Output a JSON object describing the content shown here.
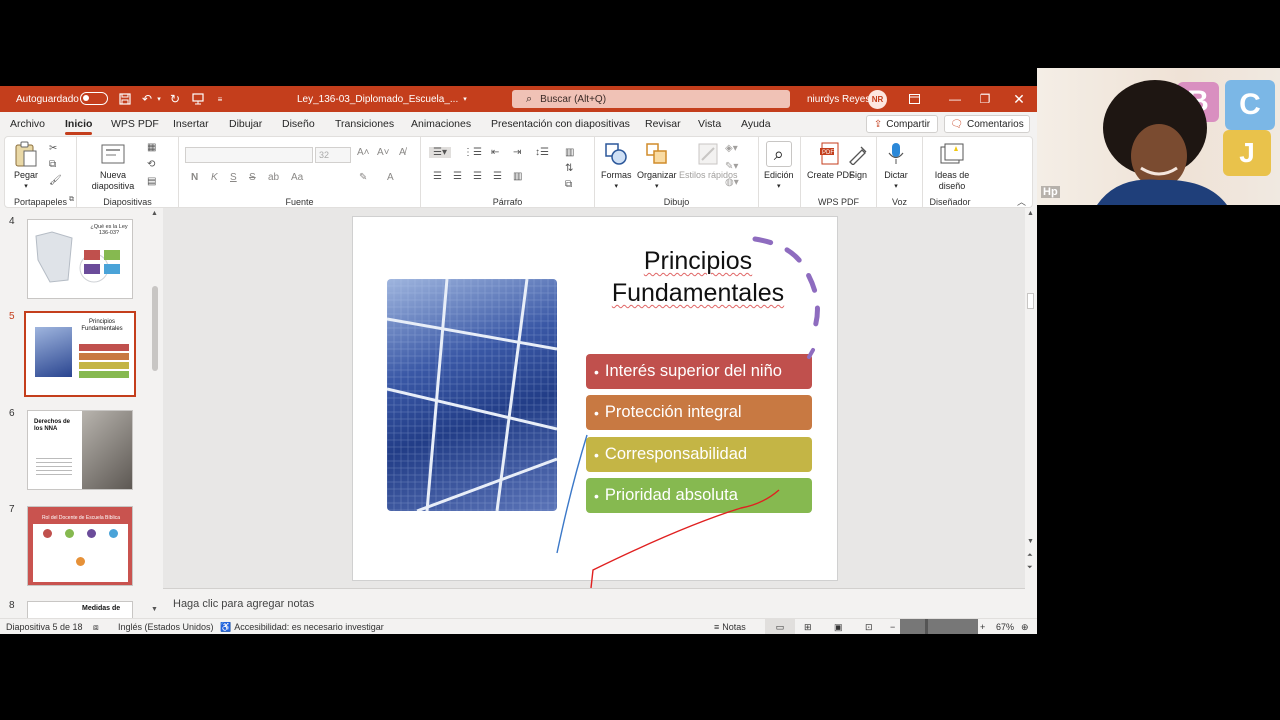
{
  "titlebar": {
    "autosave_label": "Autoguardado",
    "filename": "Ley_136-03_Diplomado_Escuela_...",
    "search_placeholder": "Buscar (Alt+Q)",
    "user_name": "niurdys Reyes",
    "user_initials": "NR"
  },
  "tabs": [
    "Archivo",
    "Inicio",
    "WPS PDF",
    "Insertar",
    "Dibujar",
    "Diseño",
    "Transiciones",
    "Animaciones",
    "Presentación con diapositivas",
    "Revisar",
    "Vista",
    "Ayuda"
  ],
  "active_tab": "Inicio",
  "share_label": "Compartir",
  "comments_label": "Comentarios",
  "ribbon": {
    "groups": {
      "clipboard": "Portapapeles",
      "slides": "Diapositivas",
      "font": "Fuente",
      "paragraph": "Párrafo",
      "drawing": "Dibujo",
      "wpspdf": "WPS PDF",
      "voice": "Voz",
      "designer": "Diseñador"
    },
    "buttons": {
      "paste": "Pegar",
      "new_slide": "Nueva diapositiva",
      "font_size": "32",
      "shapes": "Formas",
      "arrange": "Organizar",
      "quick_styles": "Estilos rápidos",
      "editing": "Edición",
      "create_pdf": "Create PDF",
      "sign": "Sign",
      "dictate": "Dictar",
      "design_ideas": "Ideas de diseño"
    }
  },
  "thumbnails": [
    {
      "num": "4",
      "title": "¿Qué es la Ley 136-03?"
    },
    {
      "num": "5",
      "title": "Principios Fundamentales"
    },
    {
      "num": "6",
      "title": "Derechos de los NNA"
    },
    {
      "num": "7",
      "title": "Rol del Docente de Escuela Bíblica"
    },
    {
      "num": "8",
      "title": "Medidas de"
    }
  ],
  "slide": {
    "title_line1": "Principios",
    "title_line2": "Fundamentales",
    "bullets": [
      {
        "text": "Interés superior del niño",
        "color": "#c0504d"
      },
      {
        "text": "Protección integral",
        "color": "#c87942"
      },
      {
        "text": "Corresponsabilidad",
        "color": "#c4b545"
      },
      {
        "text": "Prioridad absoluta",
        "color": "#86b950"
      }
    ]
  },
  "notes_placeholder": "Haga clic para agregar notas",
  "statusbar": {
    "slide_counter": "Diapositiva 5 de 18",
    "language": "Inglés (Estados Unidos)",
    "accessibility": "Accesibilidad: es necesario investigar",
    "notes_label": "Notas",
    "zoom": "67%"
  },
  "webcam": {
    "label": "Hp",
    "letters": [
      "B",
      "C",
      "J"
    ]
  },
  "colors": {
    "accent": "#c43e1c"
  }
}
